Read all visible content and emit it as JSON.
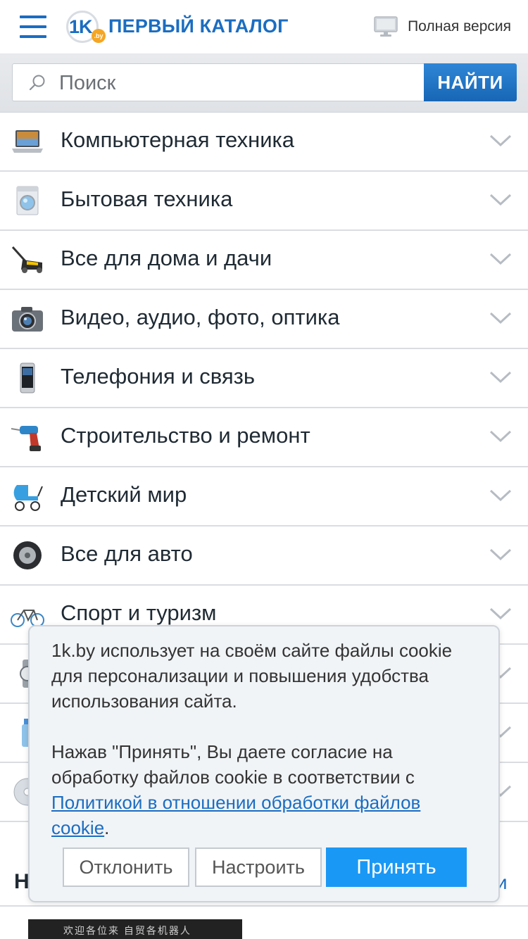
{
  "header": {
    "logo_num": "1K",
    "logo_by": ".by",
    "logo_text": "ПЕРВЫЙ КАТАЛОГ",
    "full_version_label": "Полная версия"
  },
  "search": {
    "placeholder": "Поиск",
    "button_label": "НАЙТИ"
  },
  "categories": [
    {
      "label": "Компьютерная техника",
      "icon": "laptop-icon"
    },
    {
      "label": "Бытовая техника",
      "icon": "washing-machine-icon"
    },
    {
      "label": "Все для дома и дачи",
      "icon": "lawn-mower-icon"
    },
    {
      "label": "Видео, аудио, фото, оптика",
      "icon": "camera-icon"
    },
    {
      "label": "Телефония и связь",
      "icon": "smartphone-icon"
    },
    {
      "label": "Строительство и ремонт",
      "icon": "drill-icon"
    },
    {
      "label": "Детский мир",
      "icon": "stroller-icon"
    },
    {
      "label": "Все для авто",
      "icon": "tire-icon"
    },
    {
      "label": "Спорт и туризм",
      "icon": "bicycle-icon"
    },
    {
      "label": "",
      "icon": "watch-icon"
    },
    {
      "label": "",
      "icon": "bottle-icon"
    },
    {
      "label": "",
      "icon": "disc-icon"
    }
  ],
  "section": {
    "title": "Н",
    "link": "ти"
  },
  "thumbnail_text": "欢迎各位来 自贸各机器人",
  "cookie": {
    "text1": "1k.by использует на своём сайте файлы cookie для персонализации и повышения удобства использования сайта.",
    "text2_before": "Нажав \"Принять\", Вы даете согласие на обработку файлов cookie в соответствии с ",
    "link": "Политикой в отношении обработки файлов cookie",
    "text2_after": ".",
    "decline": "Отклонить",
    "settings": "Настроить",
    "accept": "Принять"
  },
  "colors": {
    "brand": "#1b6dc1",
    "accept": "#1a98f5",
    "search_button": "#1766b5"
  }
}
